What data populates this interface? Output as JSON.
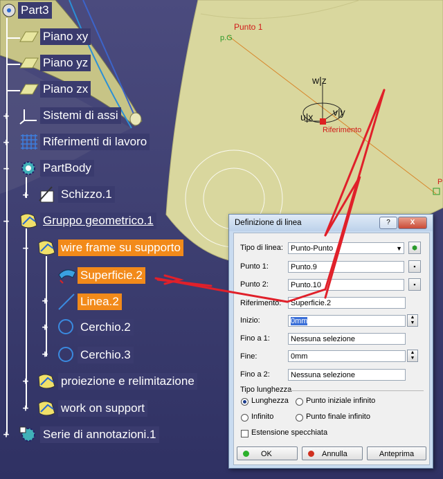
{
  "tree": {
    "root": "Part3",
    "items": [
      {
        "label": "Piano xy"
      },
      {
        "label": "Piano yz"
      },
      {
        "label": "Piano zx"
      },
      {
        "label": "Sistemi di assi"
      },
      {
        "label": "Riferimenti di lavoro"
      },
      {
        "label": "PartBody"
      },
      {
        "label": "Schizzo.1"
      },
      {
        "label": "Gruppo geometrico.1"
      },
      {
        "label": "wire frame su supporto"
      },
      {
        "label": "Superficie.2"
      },
      {
        "label": "Linea.2"
      },
      {
        "label": "Cerchio.2"
      },
      {
        "label": "Cerchio.3"
      },
      {
        "label": "proiezione e relimitazione"
      },
      {
        "label": "work on support"
      },
      {
        "label": "Serie di annotazioni.1"
      }
    ]
  },
  "viewport": {
    "point_label": "Punto 1",
    "point_short": "p.G",
    "axis_w": "w|z",
    "axis_u": "u|x",
    "axis_v": "v|y",
    "reference_label": "Riferimento",
    "edge_label": "P"
  },
  "dialog": {
    "title": "Definizione di linea",
    "help_btn": "?",
    "close_btn": "X",
    "line_type_label": "Tipo di linea:",
    "line_type_value": "Punto-Punto",
    "point1_label": "Punto 1:",
    "point1_value": "Punto.9",
    "point2_label": "Punto 2:",
    "point2_value": "Punto.10",
    "support_label": "Riferimento:",
    "support_value": "Superficie.2",
    "start_label": "Inizio:",
    "start_value": "0mm",
    "upto1_label": "Fino a 1:",
    "upto1_value": "Nessuna selezione",
    "end_label": "Fine:",
    "end_value": "0mm",
    "upto2_label": "Fino a 2:",
    "upto2_value": "Nessuna selezione",
    "length_type_title": "Tipo lunghezza",
    "opt_length": "Lunghezza",
    "opt_start_infinite": "Punto iniziale infinito",
    "opt_infinite": "Infinito",
    "opt_end_infinite": "Punto finale infinito",
    "mirror_label": "Estensione specchiata",
    "ok": "OK",
    "cancel": "Annulla",
    "preview": "Anteprima"
  },
  "colors": {
    "background": "#3f4072",
    "highlight": "#f28a1a",
    "surface": "#d6d49a",
    "annotation": "#e0202a"
  }
}
